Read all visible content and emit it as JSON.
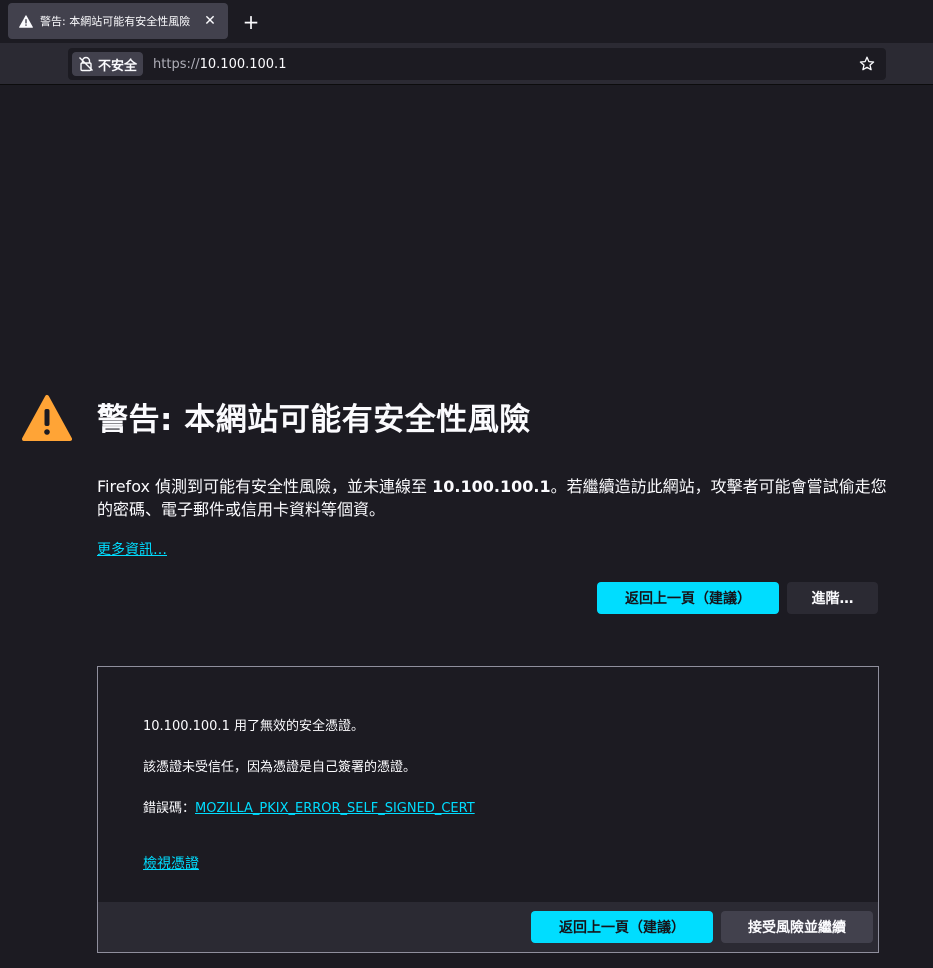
{
  "browser": {
    "tab": {
      "title": "警告: 本網站可能有安全性風險",
      "close_glyph": "✕"
    },
    "newtab_glyph": "+",
    "urlbar": {
      "identity_label": "不安全",
      "url_scheme": "https://",
      "url_host": "10.100.100.1"
    }
  },
  "page": {
    "title": "警告: 本網站可能有安全性風險",
    "desc_prefix": "Firefox 偵測到可能有安全性風險，並未連線至 ",
    "desc_host": "10.100.100.1",
    "desc_suffix": "。若繼續造訪此網站，攻擊者可能會嘗試偷走您的密碼、電子郵件或信用卡資料等個資。",
    "learn_more": "更多資訊…",
    "back_button": "返回上一頁（建議）",
    "advanced_button": "進階…"
  },
  "advanced": {
    "line1": "10.100.100.1 用了無效的安全憑證。",
    "line2": "該憑證未受信任，因為憑證是自己簽署的憑證。",
    "error_code_label": "錯誤碼：",
    "error_code": "MOZILLA_PKIX_ERROR_SELF_SIGNED_CERT",
    "view_certificate": "檢視憑證",
    "back_button": "返回上一頁（建議）",
    "accept_button": "接受風險並繼續"
  },
  "colors": {
    "accent": "#00ddff",
    "warning": "#ffa436",
    "background": "#1c1b22",
    "toolbar": "#2b2a33"
  }
}
